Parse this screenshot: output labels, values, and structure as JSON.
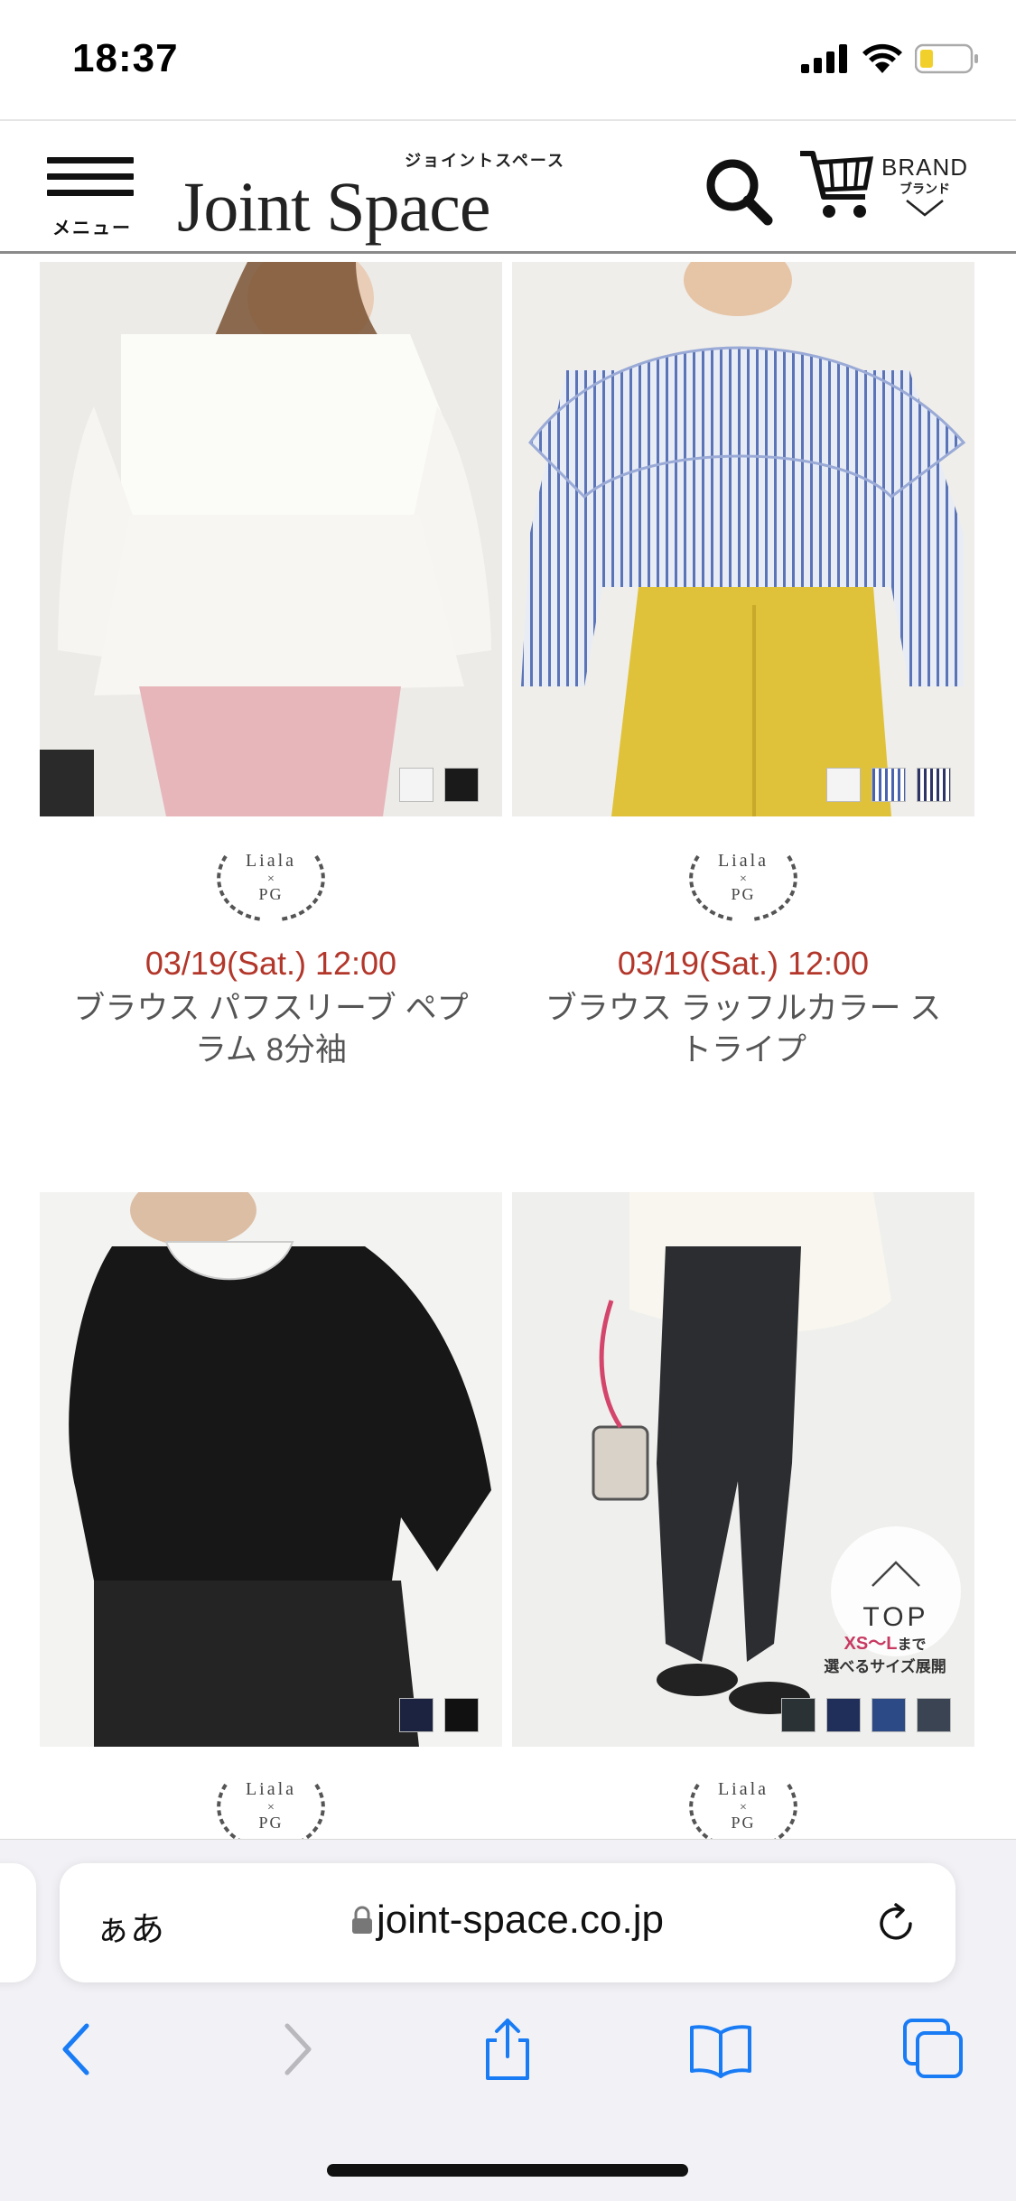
{
  "status": {
    "time": "18:37"
  },
  "header": {
    "menu_label": "メニュー",
    "logo_text": "Joint Space",
    "logo_kana": "ジョイントスペース",
    "brand_en": "BRAND",
    "brand_jp": "ブランド"
  },
  "products": [
    {
      "brand_line1": "Liala",
      "brand_line2": "×",
      "brand_line3": "PG",
      "date": "03/19(Sat.) 12:00",
      "name_line1": "ブラウス パフスリーブ ペプ",
      "name_line2": "ラム 8分袖",
      "swatches": [
        "#f4f4f4",
        "#1a1a1a"
      ]
    },
    {
      "brand_line1": "Liala",
      "brand_line2": "×",
      "brand_line3": "PG",
      "date": "03/19(Sat.) 12:00",
      "name_line1": "ブラウス ラッフルカラー ス",
      "name_line2": "トライプ",
      "swatches": [
        "#f4f4f4",
        "stripe-blue",
        "stripe-navy"
      ]
    },
    {
      "brand_line1": "Liala",
      "brand_line2": "×",
      "brand_line3": "PG",
      "swatches": [
        "#1c2340",
        "#111111"
      ]
    },
    {
      "brand_line1": "Liala",
      "brand_line2": "×",
      "brand_line3": "PG",
      "swatches": [
        "#2a3235",
        "#1f2f5a",
        "#2b4a86",
        "#3a4452"
      ]
    }
  ],
  "top_button": {
    "label": "TOP"
  },
  "size_badge": {
    "range": "XS〜L",
    "suffix": "まで",
    "text": "選べるサイズ展開"
  },
  "browser": {
    "aa_label": "ぁあ",
    "url": "joint-space.co.jp"
  },
  "colors": {
    "date_red": "#b3362a",
    "ios_blue": "#1a7cf5",
    "header_rule": "#8a8a8a"
  },
  "icons": [
    "signal-icon",
    "wifi-icon",
    "battery-icon",
    "hamburger-icon",
    "search-icon",
    "cart-icon",
    "chevron-down-icon",
    "lock-icon",
    "reload-icon",
    "back-icon",
    "forward-icon",
    "share-icon",
    "bookmarks-icon",
    "tabs-icon"
  ]
}
